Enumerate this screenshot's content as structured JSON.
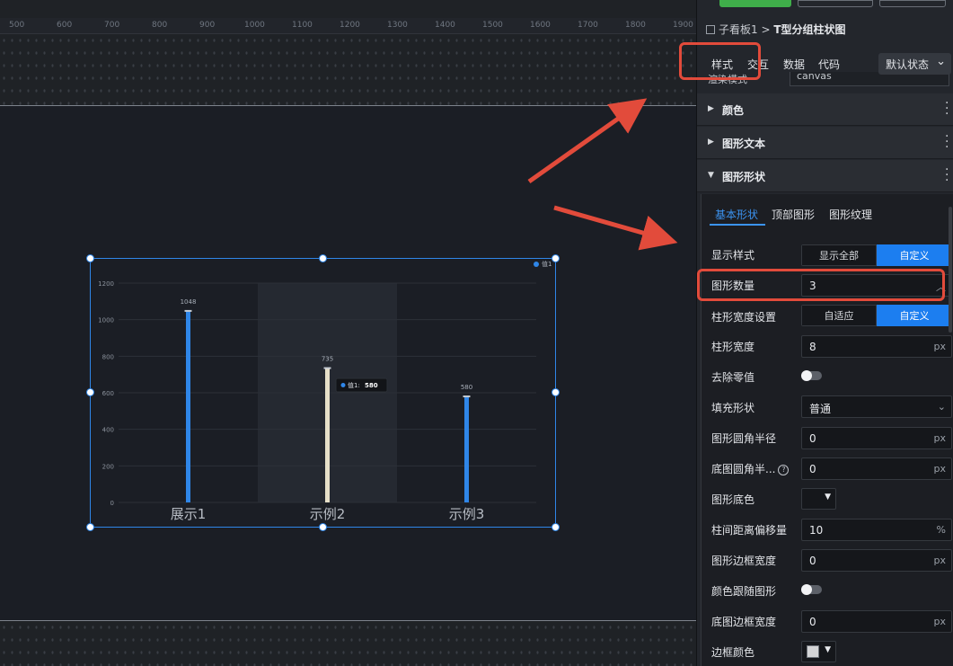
{
  "canvas": {
    "ruler_ticks": [
      "500",
      "600",
      "700",
      "800",
      "900",
      "1000",
      "1100",
      "1200",
      "1300",
      "1400",
      "1500",
      "1600",
      "1700",
      "1800",
      "1900"
    ]
  },
  "chart_data": {
    "type": "bar",
    "categories": [
      "展示1",
      "示例2",
      "示例3"
    ],
    "series": [
      {
        "name": "值1",
        "values": [
          1048,
          735,
          580
        ]
      }
    ],
    "yticks": [
      "0",
      "200",
      "400",
      "600",
      "800",
      "1000",
      "1200"
    ],
    "ylim": [
      0,
      1200
    ],
    "tooltip": {
      "name": "值1",
      "value": "580"
    },
    "legend_label": "值1",
    "colors": {
      "bar": "#2f86e8",
      "highlight_bar": "#e6dfc8",
      "grid": "#2c3038"
    }
  },
  "panel": {
    "breadcrumb": {
      "parent": "子看板1",
      "sep": ">",
      "current": "T型分组柱状图"
    },
    "tabs": [
      "样式",
      "交互",
      "数据",
      "代码"
    ],
    "state_select": "默认状态",
    "peek_label": "渲染模式",
    "peek_value": "canvas",
    "sections": [
      "颜色",
      "图形文本",
      "图形形状"
    ],
    "subtabs": [
      "基本形状",
      "顶部图形",
      "图形纹理"
    ],
    "fields": {
      "display_style": {
        "label": "显示样式",
        "options": [
          "显示全部",
          "自定义"
        ],
        "selected": "自定义"
      },
      "shape_count": {
        "label": "图形数量",
        "value": "3"
      },
      "bar_width_setting": {
        "label": "柱形宽度设置",
        "options": [
          "自适应",
          "自定义"
        ],
        "selected": "自定义"
      },
      "bar_width": {
        "label": "柱形宽度",
        "value": "8",
        "unit": "px"
      },
      "remove_zero": {
        "label": "去除零值",
        "on": false
      },
      "fill_shape": {
        "label": "填充形状",
        "value": "普通"
      },
      "corner_radius": {
        "label": "图形圆角半径",
        "value": "0",
        "unit": "px"
      },
      "bg_corner_radius": {
        "label": "底图圆角半...",
        "value": "0",
        "unit": "px"
      },
      "bg_color": {
        "label": "图形底色"
      },
      "bar_gap_offset": {
        "label": "柱间距离偏移量",
        "value": "10",
        "unit": "%"
      },
      "border_width": {
        "label": "图形边框宽度",
        "value": "0",
        "unit": "px"
      },
      "color_follow": {
        "label": "颜色跟随图形",
        "on": false
      },
      "bg_border_width": {
        "label": "底图边框宽度",
        "value": "0",
        "unit": "px"
      },
      "border_color": {
        "label": "边框颜色"
      }
    }
  },
  "colors": {
    "accent": "#1c7ef0",
    "highlight": "#e24b3b",
    "green_button": "#3fae4a"
  }
}
